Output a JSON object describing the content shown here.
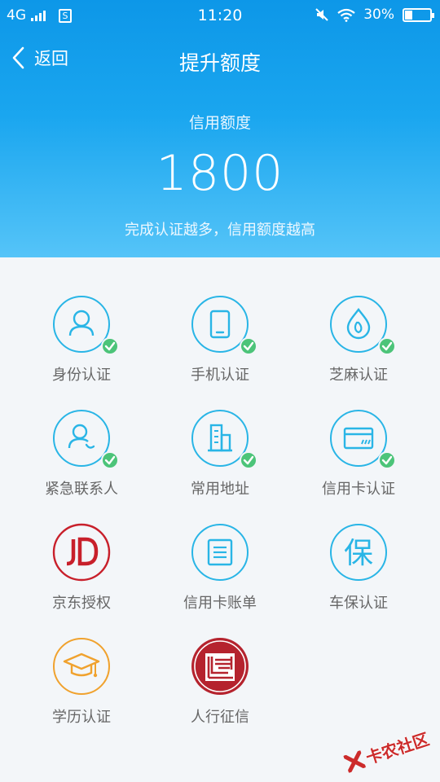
{
  "status_bar": {
    "network": "4G",
    "sim_icon": "S",
    "time": "11:20",
    "battery_percent": "30%",
    "battery_level": 0.3,
    "icons": [
      "signal-icon",
      "sim-icon",
      "mute-icon",
      "wifi-icon",
      "battery-icon"
    ]
  },
  "nav": {
    "back_label": "返回",
    "title": "提升额度"
  },
  "credit": {
    "label": "信用额度",
    "value": "1800",
    "hint": "完成认证越多，信用额度越高"
  },
  "items": [
    {
      "label": "身份认证",
      "icon": "person-icon",
      "done": true
    },
    {
      "label": "手机认证",
      "icon": "phone-icon",
      "done": true
    },
    {
      "label": "芝麻认证",
      "icon": "sesame-icon",
      "done": true
    },
    {
      "label": "紧急联系人",
      "icon": "contact-icon",
      "done": true
    },
    {
      "label": "常用地址",
      "icon": "building-icon",
      "done": true
    },
    {
      "label": "信用卡认证",
      "icon": "credit-card-icon",
      "done": true
    },
    {
      "label": "京东授权",
      "icon": "jd-logo",
      "done": false
    },
    {
      "label": "信用卡账单",
      "icon": "bill-icon",
      "done": false
    },
    {
      "label": "车保认证",
      "icon": "insurance-icon",
      "done": false
    },
    {
      "label": "学历认证",
      "icon": "graduation-cap-icon",
      "done": false
    },
    {
      "label": "人行征信",
      "icon": "pboc-logo",
      "done": false
    }
  ],
  "icon_glyph": {
    "insurance": "保"
  },
  "colors": {
    "header_start": "#0d97e8",
    "header_end": "#55c4f8",
    "icon_blue": "#29b5e6",
    "check_green": "#4cc479",
    "jd_red": "#c8202b",
    "edu_orange": "#f0a22e",
    "pboc_red": "#b5232e"
  },
  "watermark": {
    "text": "卡农社区"
  }
}
